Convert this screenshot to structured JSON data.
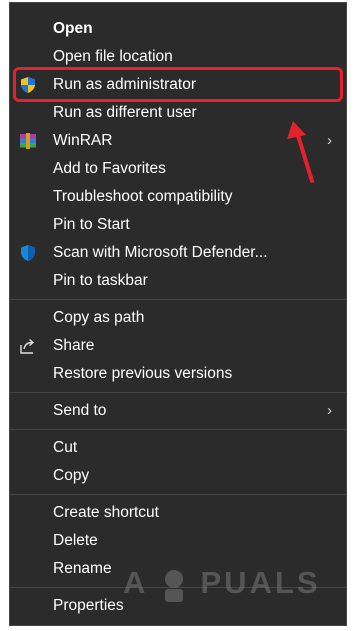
{
  "menu": {
    "items": [
      {
        "label": "Open",
        "bold": true
      },
      {
        "label": "Open file location"
      },
      {
        "label": "Run as administrator",
        "icon": "uac-shield-icon"
      },
      {
        "label": "Run as different user"
      },
      {
        "label": "WinRAR",
        "icon": "winrar-icon",
        "submenu": true
      },
      {
        "label": "Add to Favorites"
      },
      {
        "label": "Troubleshoot compatibility"
      },
      {
        "label": "Pin to Start"
      },
      {
        "label": "Scan with Microsoft Defender...",
        "icon": "defender-shield-icon"
      },
      {
        "label": "Pin to taskbar"
      },
      {
        "label": "Copy as path"
      },
      {
        "label": "Share",
        "icon": "share-icon"
      },
      {
        "label": "Restore previous versions"
      },
      {
        "label": "Send to",
        "submenu": true
      },
      {
        "label": "Cut"
      },
      {
        "label": "Copy"
      },
      {
        "label": "Create shortcut"
      },
      {
        "label": "Delete"
      },
      {
        "label": "Rename"
      },
      {
        "label": "Properties"
      }
    ],
    "submenu_glyph": "›"
  },
  "watermark": {
    "text_left": "A",
    "text_right": "PUALS"
  },
  "colors": {
    "menu_bg": "#2b2b2b",
    "highlight": "#e5222b",
    "text": "#ffffff"
  }
}
